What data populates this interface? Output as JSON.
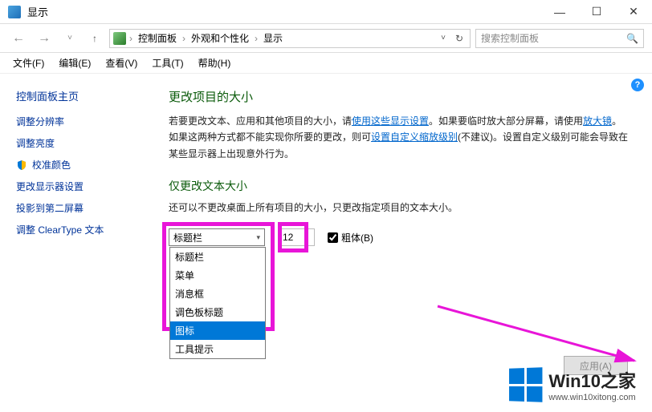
{
  "window": {
    "title": "显示",
    "min": "—",
    "max": "☐",
    "close": "✕"
  },
  "nav": {
    "back": "←",
    "forward": "→",
    "down": "˅",
    "up": "↑",
    "crumbs": [
      "控制面板",
      "外观和个性化",
      "显示"
    ],
    "sep": "›",
    "refresh": "↻",
    "search_placeholder": "搜索控制面板"
  },
  "menu": [
    "文件(F)",
    "编辑(E)",
    "查看(V)",
    "工具(T)",
    "帮助(H)"
  ],
  "sidebar": {
    "title": "控制面板主页",
    "items": [
      {
        "label": "调整分辨率",
        "shield": false
      },
      {
        "label": "调整亮度",
        "shield": false
      },
      {
        "label": "校准颜色",
        "shield": true
      },
      {
        "label": "更改显示器设置",
        "shield": false
      },
      {
        "label": "投影到第二屏幕",
        "shield": false
      },
      {
        "label": "调整 ClearType 文本",
        "shield": false
      }
    ]
  },
  "content": {
    "heading1": "更改项目的大小",
    "para_parts": {
      "p1": "若要更改文本、应用和其他项目的大小，请",
      "link1": "使用这些显示设置",
      "p2": "。如果要临时放大部分屏幕，请使用",
      "link2": "放大镜",
      "p3": "。如果这两种方式都不能实现你所要的更改，则可",
      "link3": "设置自定义缩放级别",
      "p4": "(不建议)。设置自定义级别可能会导致在某些显示器上出现意外行为。"
    },
    "heading2": "仅更改文本大小",
    "sub": "还可以不更改桌面上所有项目的大小，只更改指定项目的文本大小。",
    "combo_value": "标题栏",
    "font_size": "12",
    "bold_label": "粗体(B)",
    "bold_checked": true,
    "dropdown_options": [
      "标题栏",
      "菜单",
      "消息框",
      "调色板标题",
      "图标",
      "工具提示"
    ],
    "dropdown_selected": "图标",
    "apply_label": "应用(A)"
  },
  "watermark": {
    "big": "Win10之家",
    "small": "www.win10xitong.com"
  },
  "annotations": {
    "highlight_color": "#e815d8",
    "arrow_color": "#e815d8"
  }
}
